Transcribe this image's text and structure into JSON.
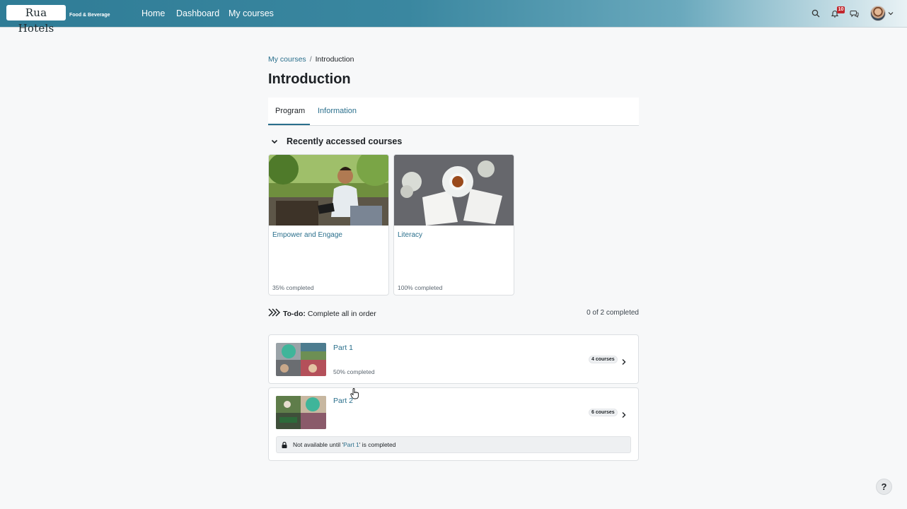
{
  "navbar": {
    "logo_text": "Rua Hotels",
    "logo_subtitle": "Food & Beverage",
    "links": [
      "Home",
      "Dashboard",
      "My courses"
    ],
    "notification_count": "10",
    "icons": [
      "search-icon",
      "bell-icon",
      "chat-icon",
      "avatar",
      "chevron-down-icon"
    ]
  },
  "breadcrumb": {
    "parent": "My courses",
    "separator": "/",
    "current": "Introduction"
  },
  "page": {
    "title": "Introduction"
  },
  "tabs": [
    {
      "label": "Program",
      "active": true
    },
    {
      "label": "Information",
      "active": false
    }
  ],
  "recent": {
    "title": "Recently accessed courses",
    "courses": [
      {
        "title": "Empower and Engage",
        "progress": "35% completed"
      },
      {
        "title": "Literacy",
        "progress": "100% completed"
      }
    ]
  },
  "todo": {
    "label": "To-do:",
    "text": "Complete all in order",
    "summary": "0 of 2 completed"
  },
  "parts": [
    {
      "title": "Part 1",
      "progress": "50% completed",
      "count": "4 courses"
    },
    {
      "title": "Part 2",
      "count": "6 courses",
      "lock_prefix": "Not available until '",
      "lock_link": "Part 1",
      "lock_suffix": "' is completed"
    }
  ],
  "help": {
    "label": "?"
  },
  "colors": {
    "accent": "#2a6f8c",
    "nav_start": "#2f7c96",
    "badge": "#c1272d"
  }
}
